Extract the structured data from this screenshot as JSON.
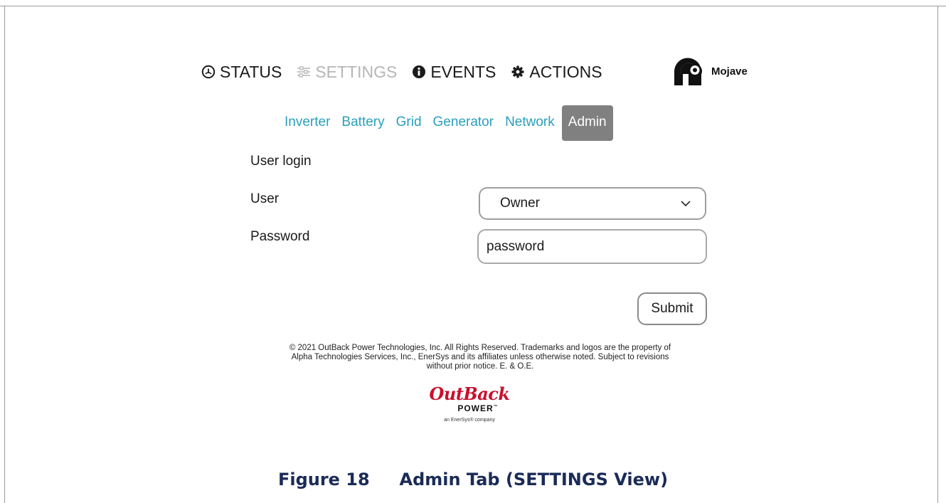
{
  "topnav": {
    "items": [
      {
        "label": "STATUS",
        "icon": "gauge-icon",
        "active": false
      },
      {
        "label": "SETTINGS",
        "icon": "sliders-icon",
        "active": true
      },
      {
        "label": "EVENTS",
        "icon": "info-icon",
        "active": false
      },
      {
        "label": "ACTIONS",
        "icon": "gear-icon",
        "active": false
      }
    ],
    "user": {
      "name": "Mojave",
      "icon": "user-avatar-icon"
    }
  },
  "subtabs": {
    "items": [
      {
        "label": "Inverter"
      },
      {
        "label": "Battery"
      },
      {
        "label": "Grid"
      },
      {
        "label": "Generator"
      },
      {
        "label": "Network"
      },
      {
        "label": "Admin",
        "active": true
      }
    ]
  },
  "form": {
    "title": "User login",
    "user_label": "User",
    "user_value": "Owner",
    "password_label": "Password",
    "password_value": "password",
    "submit_label": "Submit"
  },
  "footer": {
    "copyright_line1": "© 2021 OutBack Power Technologies, Inc. All Rights Reserved. Trademarks and logos are the property of",
    "copyright_line2": "Alpha Technologies Services, Inc., EnerSys and its affiliates unless otherwise noted. Subject to revisions",
    "copyright_line3": "without prior notice. E. & O.E.",
    "logo_line1": "OutBack",
    "logo_line2": "POWER",
    "logo_tm": "™",
    "logo_line3": "an EnerSys® company"
  },
  "caption": {
    "figure": "Figure 18",
    "title": "Admin Tab (SETTINGS View)"
  },
  "colors": {
    "tab_link": "#2a9fbd",
    "tab_active_bg": "#808080",
    "nav_dim": "#b6b6b6",
    "logo_red": "#c8102e",
    "caption_navy": "#1b2b57"
  }
}
